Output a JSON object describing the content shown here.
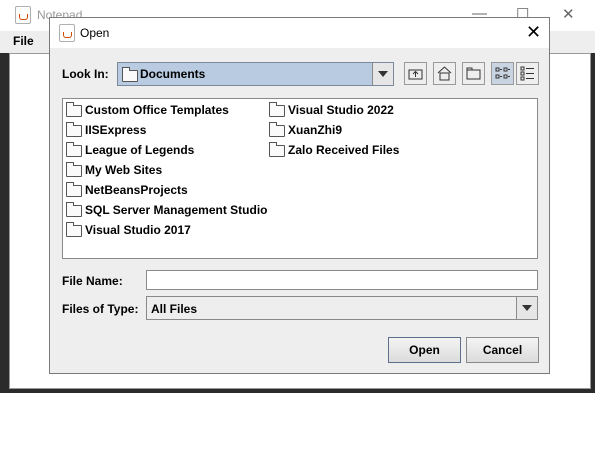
{
  "background_window": {
    "title": "Notepad",
    "menu": {
      "file": "File"
    },
    "controls": {
      "minimize": "—",
      "maximize": "☐",
      "close": "✕"
    }
  },
  "dialog": {
    "title": "Open",
    "close_glyph": "✕",
    "look_in": {
      "label": "Look In:",
      "value": "Documents"
    },
    "toolbar_icons": [
      "up-one-level-icon",
      "home-icon",
      "new-folder-icon",
      "list-view-icon",
      "details-view-icon"
    ],
    "files": [
      {
        "name": "Custom Office Templates"
      },
      {
        "name": "IISExpress"
      },
      {
        "name": "League of Legends"
      },
      {
        "name": "My Web Sites"
      },
      {
        "name": "NetBeansProjects"
      },
      {
        "name": "SQL Server Management Studio"
      },
      {
        "name": "Visual Studio 2017"
      },
      {
        "name": "Visual Studio 2022"
      },
      {
        "name": "XuanZhi9"
      },
      {
        "name": "Zalo Received Files"
      }
    ],
    "file_name": {
      "label": "File Name:",
      "value": ""
    },
    "files_of_type": {
      "label": "Files of Type:",
      "value": "All Files"
    },
    "buttons": {
      "open": "Open",
      "cancel": "Cancel"
    }
  },
  "colors": {
    "combo_selected": "#b8cbe0",
    "dialog_bg": "#eeeeee",
    "accent_border": "#5b6e8a"
  }
}
